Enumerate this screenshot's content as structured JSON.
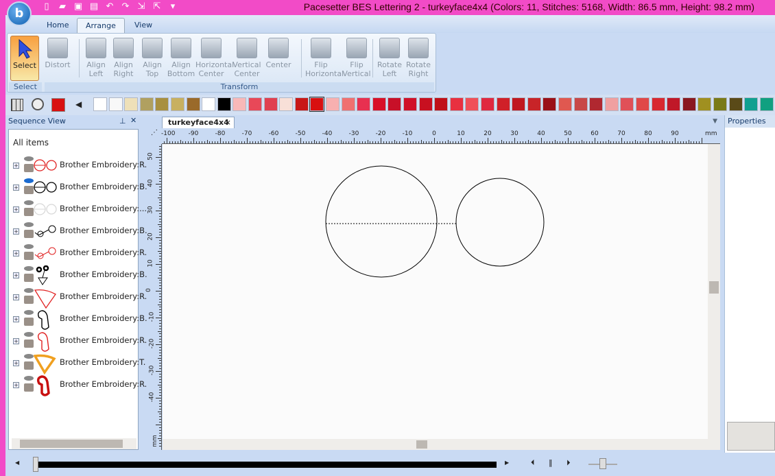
{
  "app": {
    "logo_letter": "b",
    "title": "Pacesetter BES Lettering 2 - turkeyface4x4 (Colors: 11, Stitches: 5168, Width: 86.5 mm, Height: 98.2 mm)",
    "quick_access": [
      "new-icon",
      "open-icon",
      "save-icon",
      "print-icon",
      "undo-icon",
      "redo-icon",
      "import-icon",
      "export-icon",
      "customize-icon"
    ]
  },
  "tabs": [
    {
      "label": "Home"
    },
    {
      "label": "Arrange",
      "active": true
    },
    {
      "label": "View"
    }
  ],
  "ribbon": {
    "select": {
      "label": "Select",
      "group": "Select"
    },
    "transform_group": "Transform",
    "buttons": [
      {
        "label": "Distort"
      },
      {
        "label": "Align\nLeft"
      },
      {
        "label": "Align\nRight"
      },
      {
        "label": "Align\nTop"
      },
      {
        "label": "Align\nBottom"
      },
      {
        "label": "Horizontal\nCenter"
      },
      {
        "label": "Vertical\nCenter"
      },
      {
        "label": "Center"
      },
      {
        "label": "Flip\nHorizontal"
      },
      {
        "label": "Flip\nVertical"
      },
      {
        "label": "Rotate\nLeft"
      },
      {
        "label": "Rotate\nRight"
      }
    ]
  },
  "palette": {
    "current": "#d81010",
    "selected_index": 14,
    "colors": [
      "#ffffff",
      "#f8f8f8",
      "#eee0b8",
      "#b0a060",
      "#a89040",
      "#c8b060",
      "#9a6a2a",
      "#ffffff",
      "#000000",
      "#f8b8b8",
      "#e84858",
      "#e04050",
      "#f8e0d8",
      "#c81818",
      "#d81010",
      "#f8b0b0",
      "#f07070",
      "#e83050",
      "#d81028",
      "#c81028",
      "#d01028",
      "#c81020",
      "#c01018",
      "#e83040",
      "#f05058",
      "#e02840",
      "#d02028",
      "#c01820",
      "#c82428",
      "#9a1018",
      "#e05850",
      "#c84848",
      "#b02830",
      "#f0a0a0",
      "#e05058",
      "#e04848",
      "#d82830",
      "#c01828",
      "#8a1820",
      "#a09020",
      "#7a7a18",
      "#5a4a18",
      "#10a090",
      "#10a080"
    ]
  },
  "sequence": {
    "title": "Sequence View",
    "root": "All items",
    "items": [
      {
        "label": "Brother Embroidery:R.",
        "color": "#e02020",
        "shape": "double-circle",
        "visible": false
      },
      {
        "label": "Brother Embroidery:B.",
        "color": "#000000",
        "shape": "double-circle",
        "visible": true
      },
      {
        "label": "Brother Embroidery:...",
        "color": "#d8d8d8",
        "shape": "double-circle",
        "visible": false
      },
      {
        "label": "Brother Embroidery:B.",
        "color": "#000000",
        "shape": "small-circles",
        "visible": false
      },
      {
        "label": "Brother Embroidery:R.",
        "color": "#e02020",
        "shape": "small-circles",
        "visible": false
      },
      {
        "label": "Brother Embroidery:B.",
        "color": "#000000",
        "shape": "beak-dots",
        "visible": false
      },
      {
        "label": "Brother Embroidery:R.",
        "color": "#e02020",
        "shape": "triangle",
        "visible": false
      },
      {
        "label": "Brother Embroidery:B.",
        "color": "#000000",
        "shape": "wattle",
        "visible": false
      },
      {
        "label": "Brother Embroidery:R.",
        "color": "#e02020",
        "shape": "wattle",
        "visible": false
      },
      {
        "label": "Brother Embroidery:T.",
        "color": "#f0a020",
        "shape": "triangle-thick",
        "visible": false
      },
      {
        "label": "Brother Embroidery:R.",
        "color": "#c81010",
        "shape": "wattle-thick",
        "visible": false
      }
    ]
  },
  "document": {
    "tab": "turkeyface4x4",
    "unit": "mm",
    "h_ticks": [
      -100,
      -90,
      -80,
      -70,
      -60,
      -50,
      -40,
      -30,
      -20,
      -10,
      0,
      10,
      20,
      30,
      40,
      50,
      60,
      70,
      80,
      90
    ],
    "v_ticks": [
      50,
      40,
      30,
      20,
      10,
      0,
      -10,
      -20,
      -30,
      -40
    ]
  },
  "properties": {
    "title": "Properties"
  }
}
